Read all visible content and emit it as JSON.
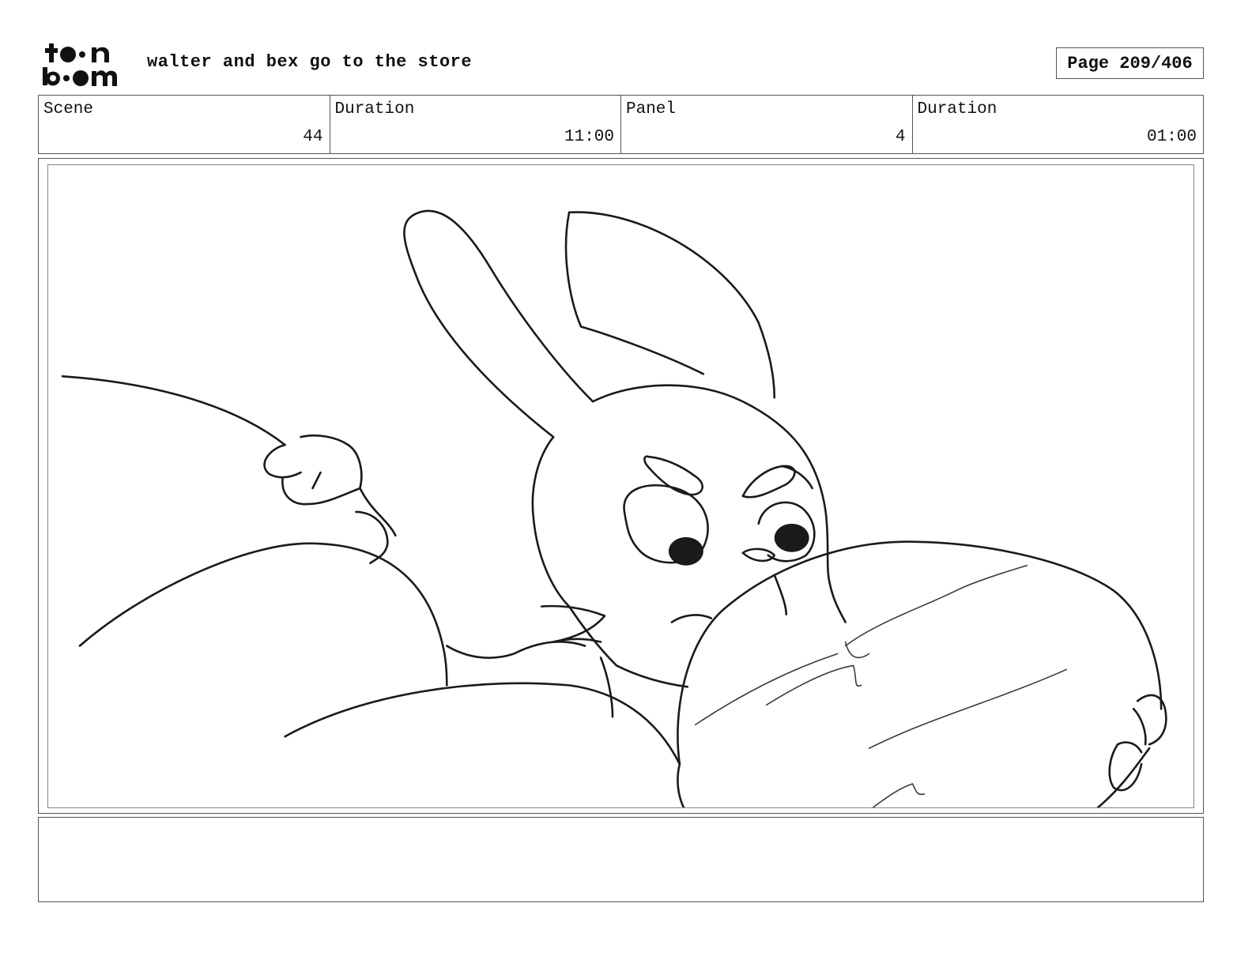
{
  "header": {
    "logo_text": "toon boom",
    "title": "walter and bex go to the store",
    "page_label": "Page 209/406"
  },
  "info": {
    "scene_label": "Scene",
    "scene_value": "44",
    "scene_duration_label": "Duration",
    "scene_duration_value": "11:00",
    "panel_label": "Panel",
    "panel_value": "4",
    "panel_duration_label": "Duration",
    "panel_duration_value": "01:00"
  },
  "panel": {
    "icon": "storyboard-sketch-rabbit-character",
    "stroke_color": "#1a1a1a"
  },
  "notes": {
    "text": ""
  }
}
